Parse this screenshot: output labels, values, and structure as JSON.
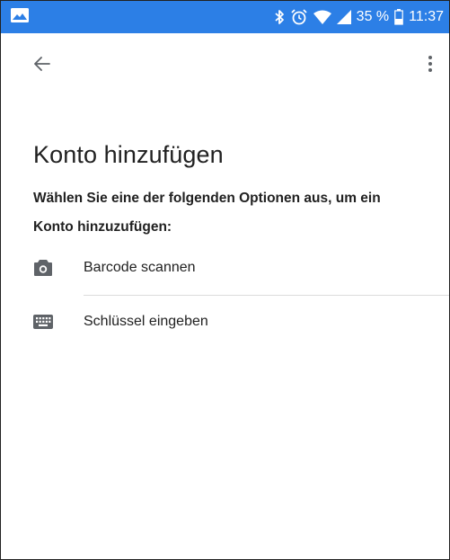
{
  "status_bar": {
    "battery": "35 %",
    "time": "11:37",
    "icons": [
      "image-notification-icon",
      "bluetooth-icon",
      "alarm-icon",
      "wifi-icon",
      "cellular-signal-icon",
      "battery-icon"
    ],
    "background_color": "#2c7fe6"
  },
  "app_bar": {
    "back_icon": "arrow-back-icon",
    "menu_icon": "more-vert-icon"
  },
  "main": {
    "title": "Konto hinzufügen",
    "instructions": "Wählen Sie eine der folgenden Optionen aus, um ein Konto hinzuzufügen:",
    "options": [
      {
        "label": "Barcode scannen",
        "icon": "camera-icon"
      },
      {
        "label": "Schlüssel eingeben",
        "icon": "keyboard-icon"
      }
    ]
  }
}
